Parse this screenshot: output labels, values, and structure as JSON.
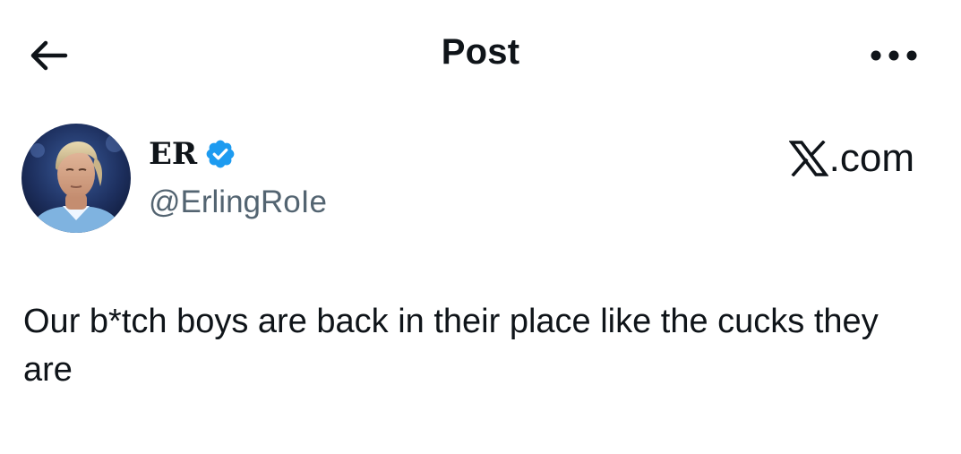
{
  "header": {
    "title": "Post",
    "back_icon": "arrow-left-icon",
    "more_icon": "more-horizontal-icon"
  },
  "author": {
    "display_name": "ER",
    "handle": "@ErlingRoIe",
    "verified": true,
    "verified_color": "#1d9bf0",
    "avatar": "avatar-photo"
  },
  "site": {
    "suffix": ".com",
    "logo_icon": "x-logo-icon"
  },
  "post": {
    "text": "Our b*tch boys are back in their place like the cucks they are"
  },
  "colors": {
    "text_primary": "#0f1419",
    "text_secondary": "#536471",
    "background": "#ffffff",
    "verified_badge": "#1d9bf0"
  }
}
